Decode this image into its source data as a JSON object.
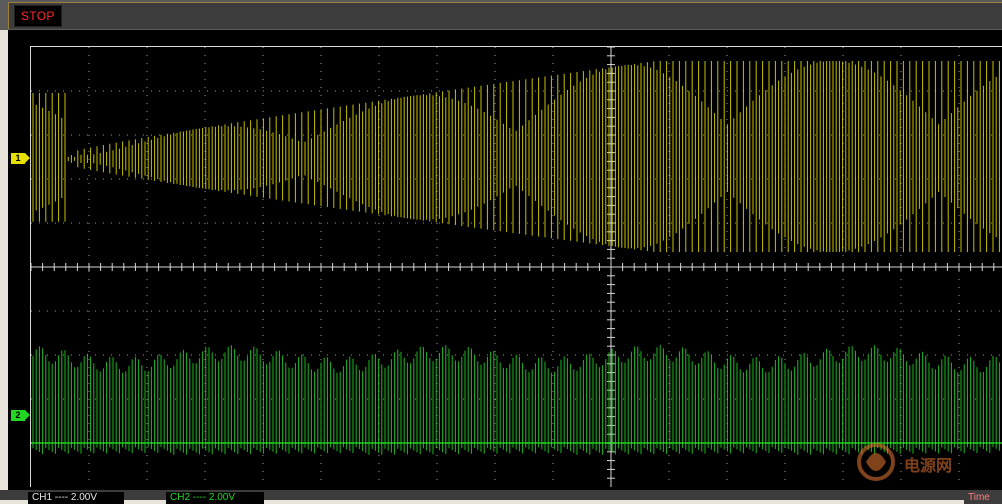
{
  "status": {
    "run_state": "STOP",
    "run_state_color": "#ff2a2a"
  },
  "channels": [
    {
      "id": "1",
      "marker": "1",
      "color": "#e8e000",
      "readout": "CH1 ---- 2.00V"
    },
    {
      "id": "2",
      "marker": "2",
      "color": "#22d822",
      "readout": "CH2 ---- 2.00V"
    }
  ],
  "time_readout": "Time",
  "watermark": {
    "logo": "logo-icon",
    "text": "电源网"
  },
  "colors": {
    "background": "#000000",
    "grid": "#d8d8d8",
    "frame": "#5a5a5a"
  }
}
